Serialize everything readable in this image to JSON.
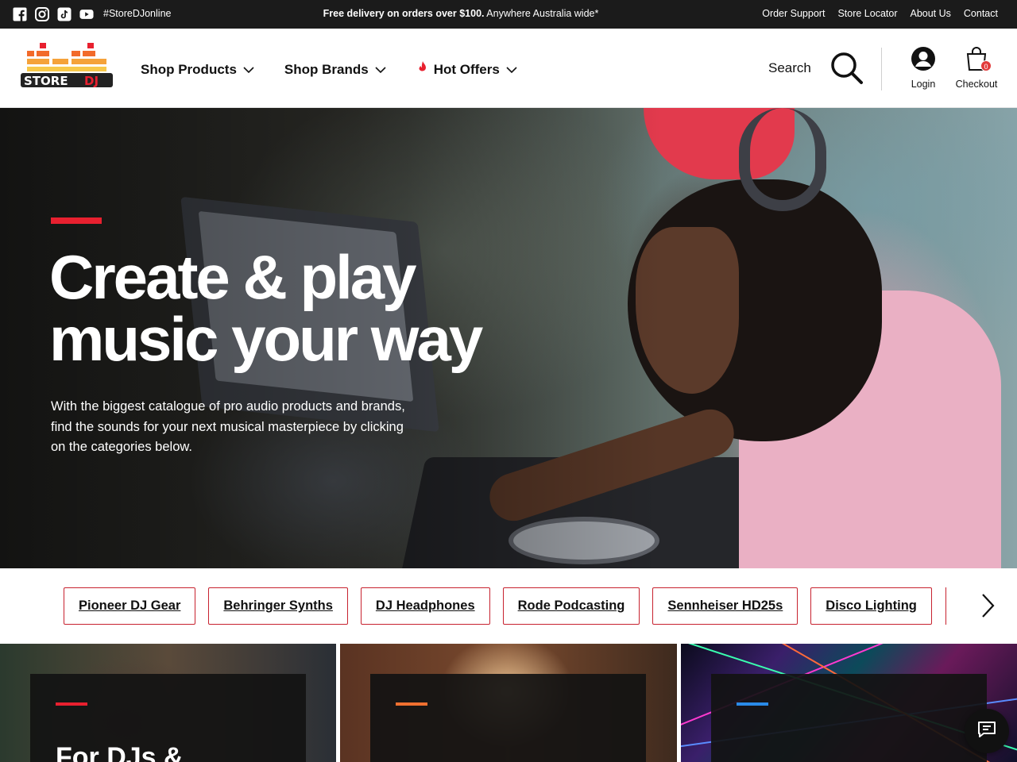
{
  "topbar": {
    "social": [
      "facebook-icon",
      "instagram-icon",
      "tiktok-icon",
      "youtube-icon"
    ],
    "hashtag": "#StoreDJonline",
    "promo_bold": "Free delivery on orders over $100.",
    "promo_rest": " Anywhere Australia wide*",
    "links": [
      "Order Support",
      "Store Locator",
      "About Us",
      "Contact"
    ]
  },
  "header": {
    "logo_alt": "STORE DJ",
    "nav": [
      {
        "label": "Shop Products"
      },
      {
        "label": "Shop Brands"
      },
      {
        "label": "Hot Offers"
      }
    ],
    "search_label": "Search",
    "login_label": "Login",
    "checkout_label": "Checkout",
    "cart_count": "0"
  },
  "hero": {
    "title_line1": "Create & play",
    "title_line2": "music your way",
    "subtitle": "With the biggest catalogue of pro audio products and brands, find the sounds for your next musical masterpiece by clicking on the categories below."
  },
  "pills": [
    "Pioneer DJ Gear",
    "Behringer Synths",
    "DJ Headphones",
    "Rode Podcasting",
    "Sennheiser HD25s",
    "Disco Lighting"
  ],
  "cards": [
    {
      "title": "For DJs &",
      "accent": "#e8202f"
    },
    {
      "title": "",
      "accent": "#f07030"
    },
    {
      "title": "",
      "accent": "#2a8ae8"
    }
  ],
  "colors": {
    "topbar_bg": "#1b1b1b",
    "brand_red": "#e8202f",
    "pill_border": "#c7222f"
  }
}
